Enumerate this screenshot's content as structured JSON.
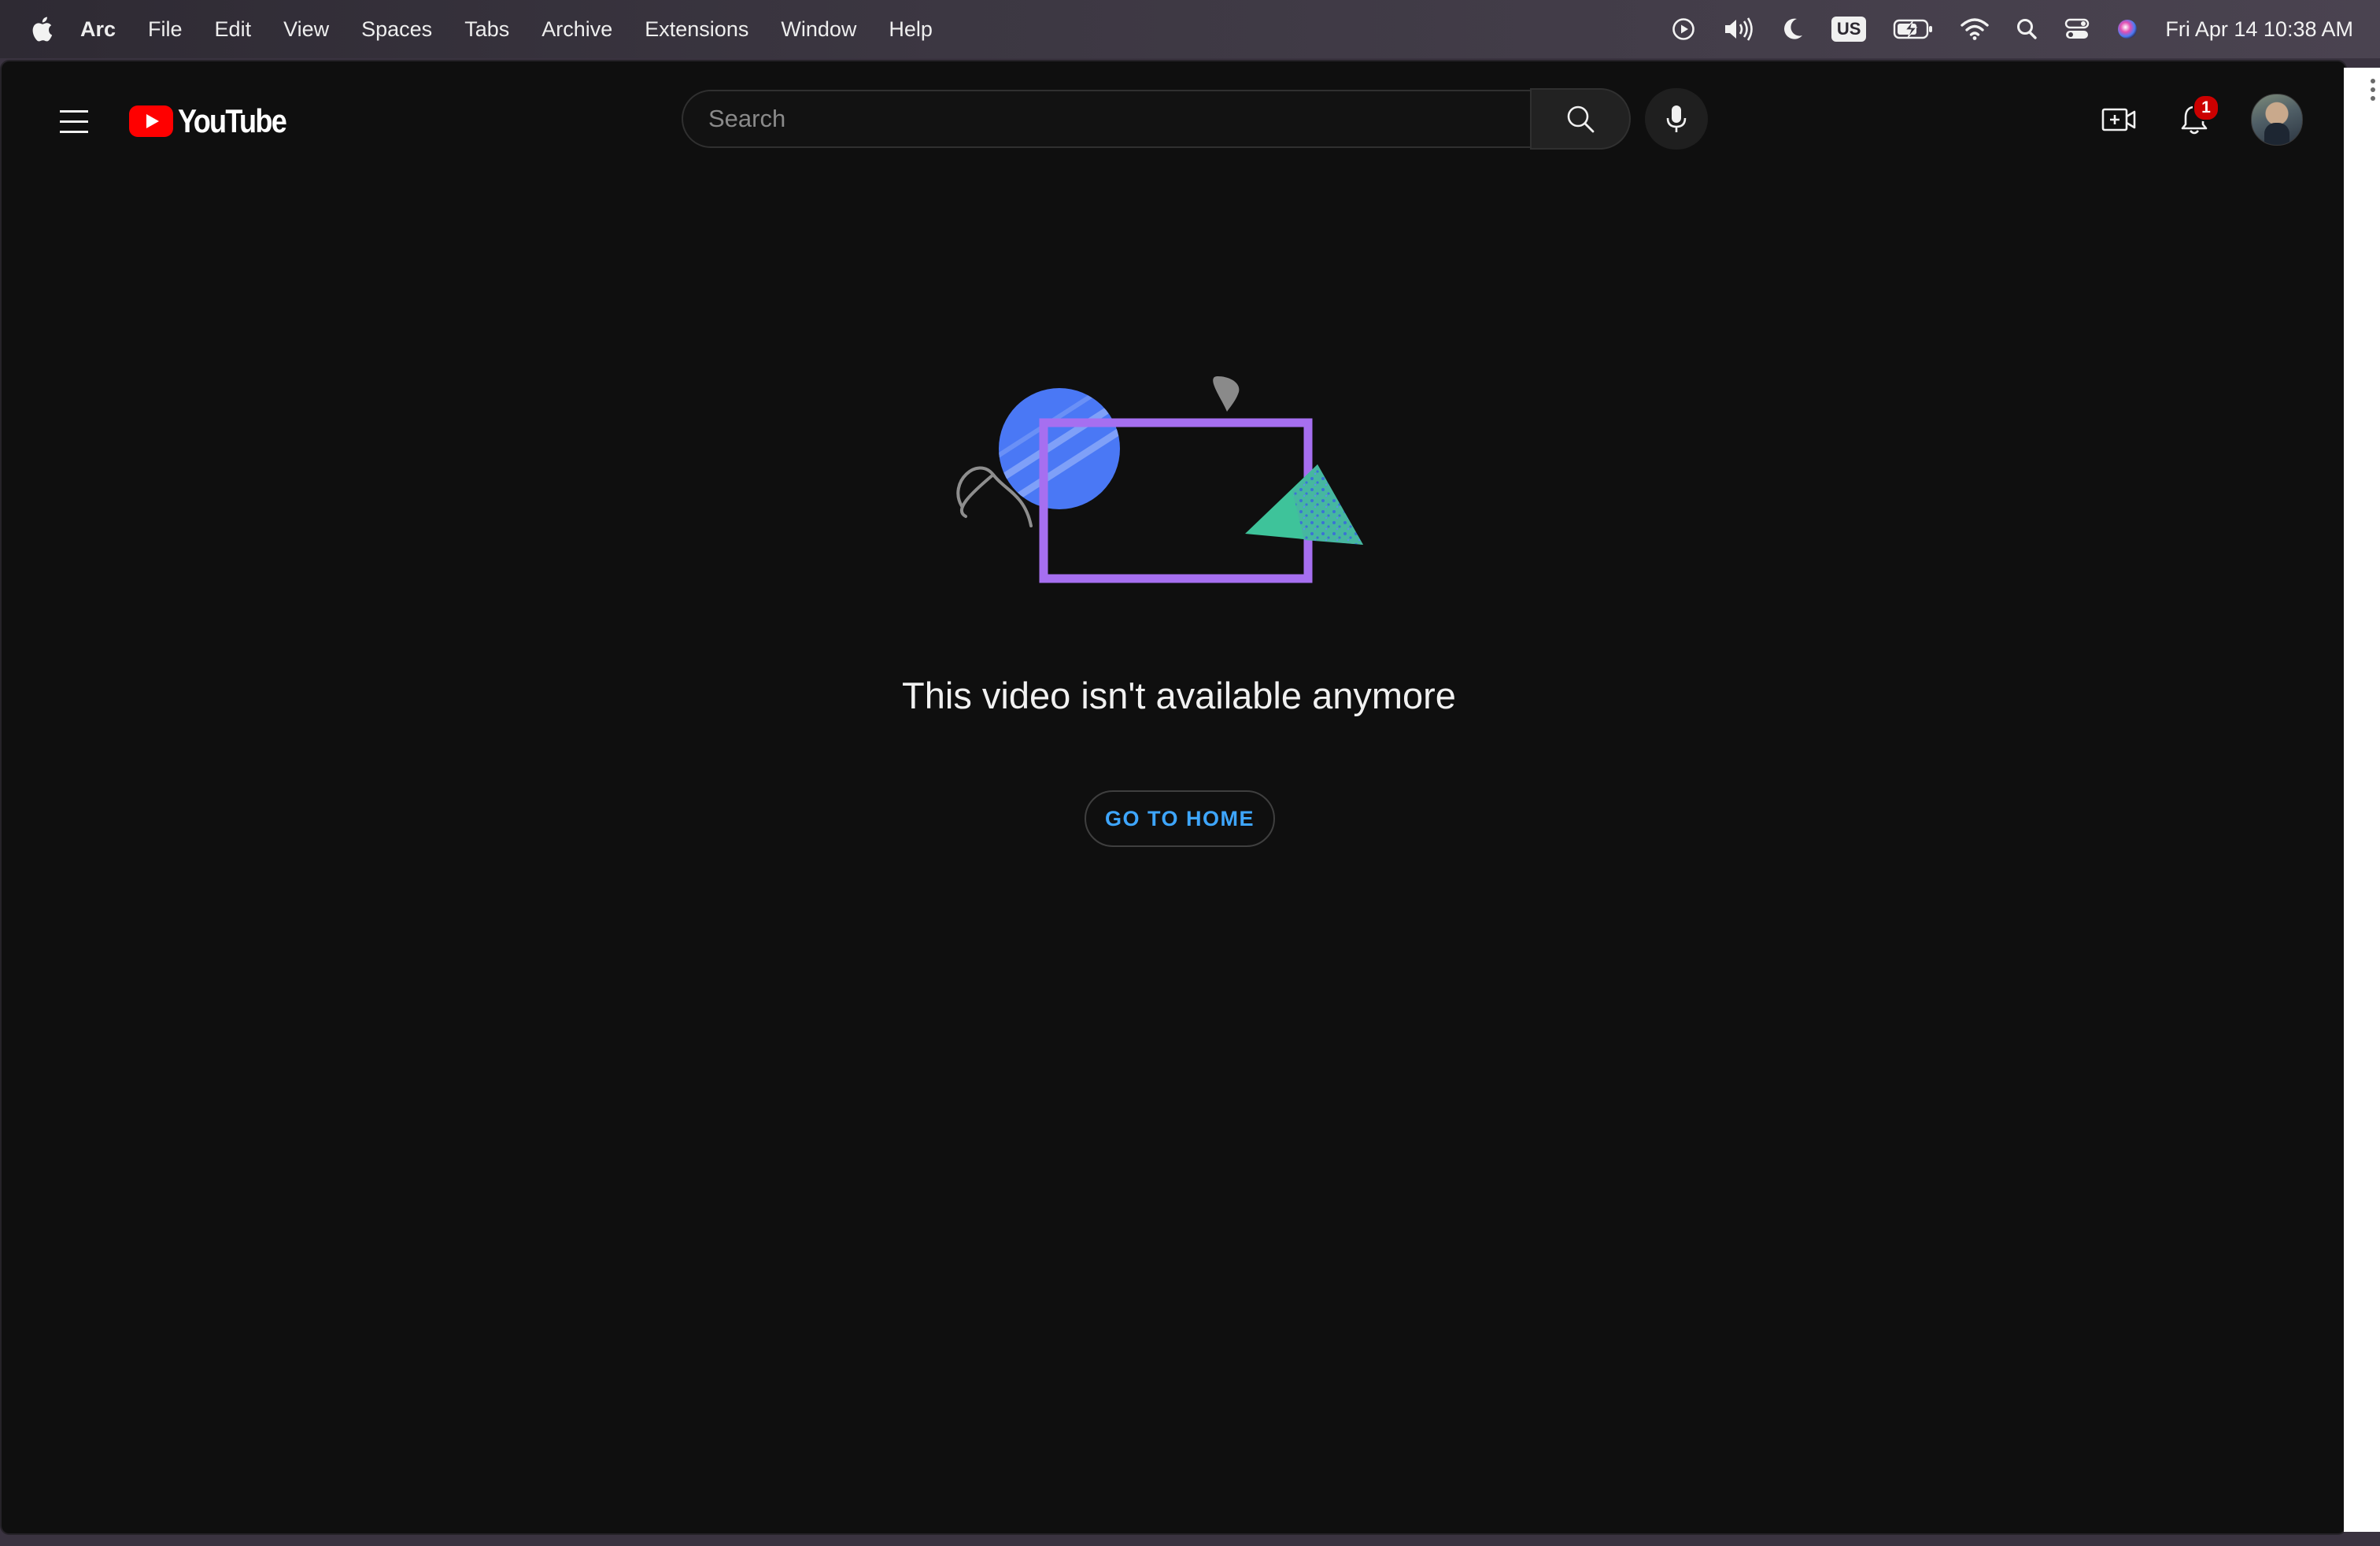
{
  "menubar": {
    "items": [
      "Arc",
      "File",
      "Edit",
      "View",
      "Spaces",
      "Tabs",
      "Archive",
      "Extensions",
      "Window",
      "Help"
    ],
    "keyboard_badge": "US",
    "clock": "Fri Apr 14  10:38 AM",
    "status_icons": [
      "play-circle-icon",
      "volume-icon",
      "moon-icon",
      "keyboard-layout-icon",
      "battery-charging-icon",
      "wifi-icon",
      "spotlight-search-icon",
      "control-center-icon",
      "siri-icon"
    ]
  },
  "youtube": {
    "logo_text": "YouTube",
    "search": {
      "placeholder": "Search",
      "value": ""
    },
    "notification_count": "1",
    "error_title": "This video isn't available anymore",
    "home_button": "GO TO HOME"
  },
  "colors": {
    "page_background": "#0f0f0f",
    "link_blue": "#3ea6ff",
    "youtube_red": "#ff0000",
    "illustration_purple": "#a66ff0",
    "illustration_blue": "#4a78f5",
    "illustration_teal": "#3ec39a"
  }
}
